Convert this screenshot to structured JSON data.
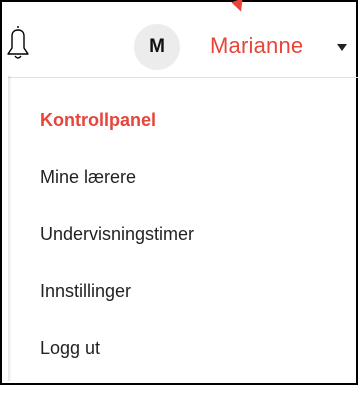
{
  "header": {
    "avatar_initial": "M",
    "username": "Marianne",
    "bell_icon": "bell-icon",
    "caret_icon": "caret-down-icon"
  },
  "menu": {
    "items": [
      {
        "label": "Kontrollpanel",
        "active": true
      },
      {
        "label": "Mine lærere",
        "active": false
      },
      {
        "label": "Undervisningstimer",
        "active": false
      },
      {
        "label": "Innstillinger",
        "active": false
      },
      {
        "label": "Logg ut",
        "active": false
      }
    ]
  },
  "colors": {
    "accent": "#e8443a",
    "text": "#222222",
    "avatar_bg": "#ececec"
  }
}
